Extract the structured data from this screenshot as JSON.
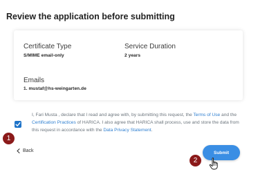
{
  "page_title": "Review the application before submitting",
  "summary": {
    "certificate_type": {
      "label": "Certificate Type",
      "value": "S/MIME email-only"
    },
    "service_duration": {
      "label": "Service Duration",
      "value": "2 years"
    },
    "emails": {
      "label": "Emails",
      "value": "1. mustaf@hs-weingarten.de"
    }
  },
  "agreement": {
    "checked": true,
    "part1": "I, Fari Musta , declare that I read and agree with, by submitting this request, the ",
    "link_terms": "Terms of Use",
    "part2": " and the ",
    "link_practices": "Certification Practices",
    "part3": " of HARICA. I also agree that HARICA shall process, use and store the data from this request in accordance with the ",
    "link_privacy": "Data Privacy Statement",
    "part4": "."
  },
  "steps": {
    "badge_1": "1",
    "badge_2": "2"
  },
  "actions": {
    "back_label": "Back",
    "submit_label": "Submit"
  },
  "colors": {
    "primary": "#3a8ee4",
    "badge": "#8b1a1a",
    "link": "#2f7fd0"
  },
  "icons": {
    "back": "chevron-left-icon",
    "cursor": "hand-pointer-icon",
    "check": "checkmark-icon"
  }
}
